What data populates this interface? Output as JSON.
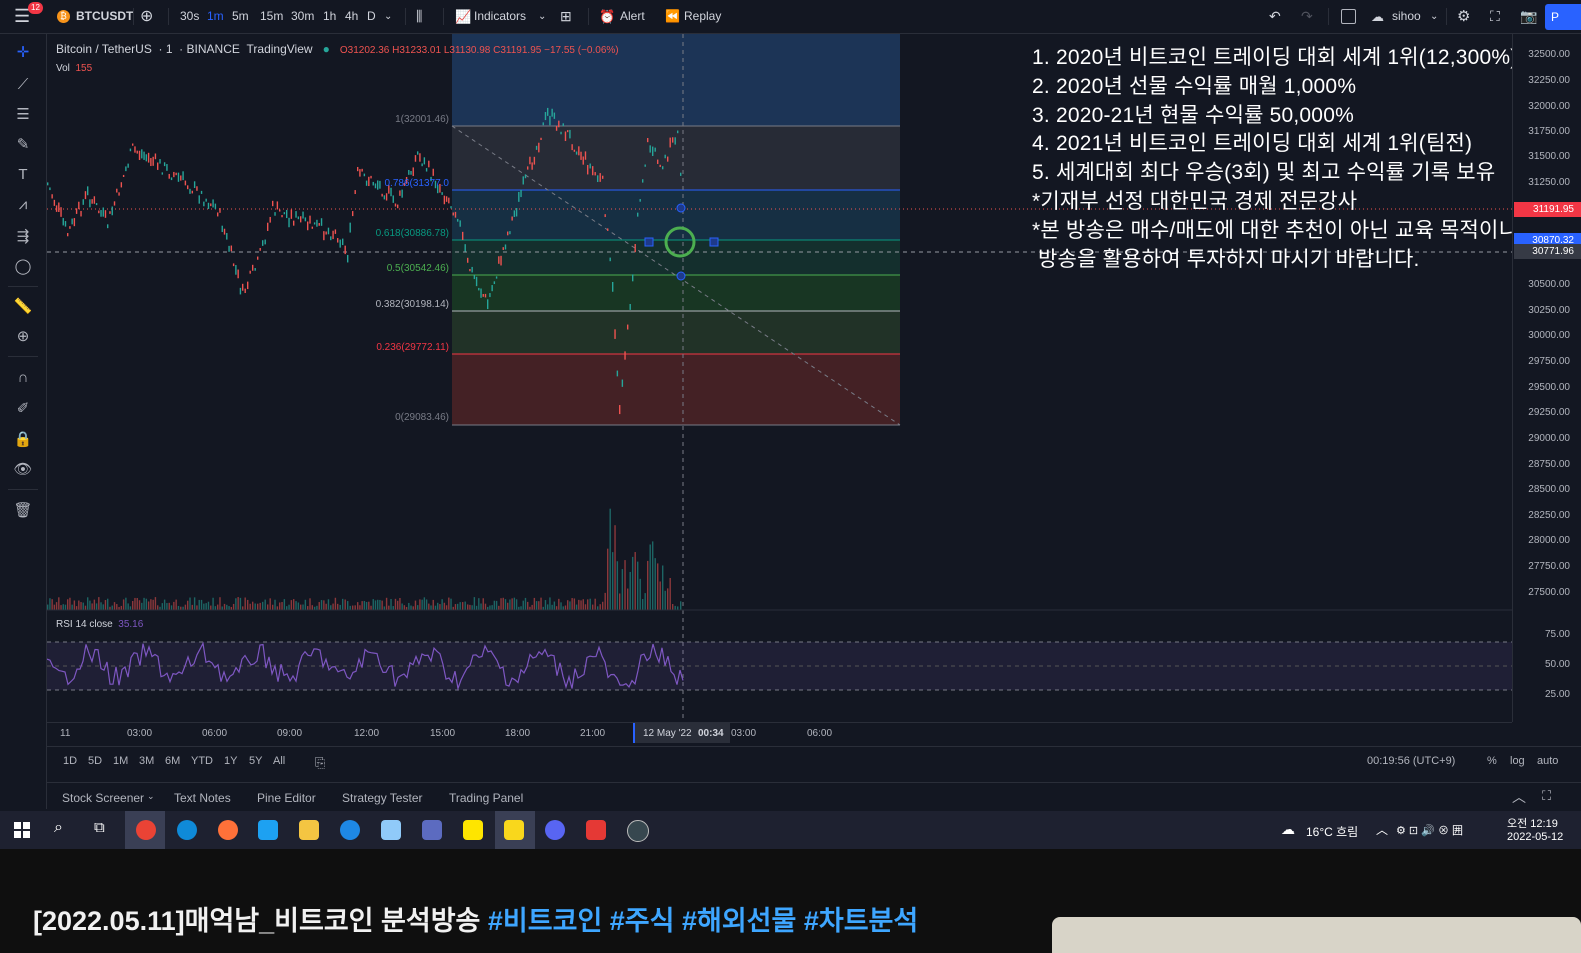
{
  "topbar": {
    "notif_count": "12",
    "symbol": "BTCUSDT",
    "intervals": [
      "30s",
      "1m",
      "5m",
      "15m",
      "30m",
      "1h",
      "4h",
      "D"
    ],
    "active_interval": "1m",
    "indicators_label": "Indicators",
    "alert_label": "Alert",
    "replay_label": "Replay",
    "layout_name": "sihoo",
    "publish_label": "P"
  },
  "legend": {
    "title": "Bitcoin / TetherUS",
    "interval": "1",
    "exchange": "BINANCE",
    "source": "TradingView",
    "ohlc": "O31202.36 H31233.01 L31130.98 C31191.95 −17.55 (−0.06%)",
    "vol_label": "Vol",
    "vol_value": "155",
    "rsi_label": "RSI 14 close",
    "rsi_value": "35.16"
  },
  "fib_levels": [
    {
      "label": "1(32001.46)",
      "color": "#787b86"
    },
    {
      "label": "0.786(31377.0",
      "color": "#2962ff"
    },
    {
      "label": "0.618(30886.78)",
      "color": "#089981"
    },
    {
      "label": "0.5(30542.46)",
      "color": "#4caf50"
    },
    {
      "label": "0.382(30198.14)",
      "color": "#b2b5be"
    },
    {
      "label": "0.236(29772.11)",
      "color": "#f23645"
    },
    {
      "label": "0(29083.46)",
      "color": "#787b86"
    }
  ],
  "overlay_text": [
    "1. 2020년 비트코인 트레이딩 대회 세계 1위(12,300%)",
    "2. 2020년 선물 수익률 매월 1,000%",
    "3. 2020-21년 현물 수익률 50,000%",
    "4. 2021년 비트코인 트레이딩 대회 세계 1위(팀전)",
    "5. 세계대회 최다 우승(3회) 및 최고 수익률 기록 보유",
    "*기재부 선정 대한민국 경제 전문강사",
    "*본 방송은 매수/매도에 대한 추천이 아닌 교육 목적이니",
    " 방송을 활용하여 투자하지 마시기 바랍니다."
  ],
  "price_axis": [
    "32500.00",
    "32250.00",
    "32000.00",
    "31750.00",
    "31500.00",
    "31250.00",
    "30500.00",
    "30250.00",
    "30000.00",
    "29750.00",
    "29500.00",
    "29250.00",
    "29000.00",
    "28750.00",
    "28500.00",
    "28250.00",
    "28000.00",
    "27750.00",
    "27500.00"
  ],
  "price_tags": {
    "current": "31191.95",
    "blue": "30870.32",
    "crosshair": "30771.96"
  },
  "rsi_axis": [
    "75.00",
    "50.00",
    "25.00"
  ],
  "time_axis": [
    "11",
    "03:00",
    "06:00",
    "09:00",
    "12:00",
    "15:00",
    "18:00",
    "21:00",
    "03:00",
    "06:00"
  ],
  "time_cursor": {
    "date": "12 May '22",
    "time": "00:34"
  },
  "range_buttons": [
    "1D",
    "5D",
    "1M",
    "3M",
    "6M",
    "YTD",
    "1Y",
    "5Y",
    "All"
  ],
  "clock": "00:19:56 (UTC+9)",
  "scale_buttons": [
    "%",
    "log",
    "auto"
  ],
  "bottom_tabs": [
    "Stock Screener",
    "Text Notes",
    "Pine Editor",
    "Strategy Tester",
    "Trading Panel"
  ],
  "taskbar": {
    "weather": "16°C 흐림",
    "ampm_time": "오전 12:19",
    "date": "2022-05-12"
  },
  "caption": {
    "title": "[2022.05.11]매억남_비트코인 분석방송",
    "tags": "#비트코인 #주식 #해외선물 #차트분석"
  },
  "colors": {
    "bg": "#131722",
    "accent": "#2962ff",
    "up": "#26a69a",
    "down": "#ef5350",
    "rsi": "#7e57c2"
  }
}
